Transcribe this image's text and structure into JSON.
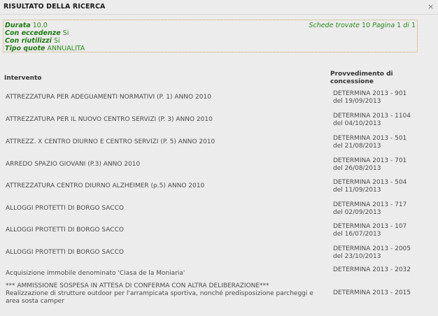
{
  "dialog": {
    "title": "RISULTATO DELLA RICERCA",
    "close_glyph": "×"
  },
  "summary": {
    "durata_label": "Durata",
    "durata_value": "10.0",
    "eccedenze_label": "Con eccedenze",
    "eccedenze_value": "Si",
    "riutilizzi_label": "Con riutilizzi",
    "riutilizzi_value": "Si",
    "tipo_label": "Tipo quote",
    "tipo_value": "ANNUALITA",
    "schede_label": "Schede trovate",
    "schede_value": "10",
    "pagina_label": "Pagina",
    "pagina_value": "1",
    "di_label": "di",
    "pagine_totali": "1"
  },
  "table": {
    "col_intervento": "Intervento",
    "col_provvedimento_1": "Provvedimento di",
    "col_provvedimento_2": "concessione",
    "rows": [
      {
        "intervento": "ATTREZZATURA PER ADEGUAMENTI NORMATIVI (P. 1) ANNO 2010",
        "prov1": "DETERMINA 2013 - 901",
        "prov2": "del 19/09/2013"
      },
      {
        "intervento": "ATTREZZATURA PER IL NUOVO CENTRO SERVIZI (P. 3) ANNO 2010",
        "prov1": "DETERMINA 2013 - 1104",
        "prov2": "del 04/10/2013"
      },
      {
        "intervento": "ATTREZZ. X CENTRO DIURNO E CENTRO SERVIZI (P. 5) ANNO 2010",
        "prov1": "DETERMINA 2013 - 501",
        "prov2": "del 21/08/2013"
      },
      {
        "intervento": "ARREDO SPAZIO GIOVANI (P.3) ANNO 2010",
        "prov1": "DETERMINA 2013 - 701",
        "prov2": "del 26/08/2013"
      },
      {
        "intervento": "ATTREZZATURA CENTRO DIURNO ALZHEIMER (p.5) ANNO 2010",
        "prov1": "DETERMINA 2013 - 504",
        "prov2": "del 11/09/2013"
      },
      {
        "intervento": "ALLOGGI PROTETTI DI BORGO SACCO",
        "prov1": "DETERMINA 2013 - 717",
        "prov2": "del 02/09/2013"
      },
      {
        "intervento": "ALLOGGI PROTETTI DI BORGO SACCO",
        "prov1": "DETERMINA 2013 - 107",
        "prov2": "del 16/07/2013"
      },
      {
        "intervento": "ALLOGGI PROTETTI DI BORGO SACCO",
        "prov1": "DETERMINA 2013 - 2005",
        "prov2": "del 23/10/2013"
      },
      {
        "intervento": "Acquisizione immobile denominato 'Ciasa de la Moniaria'",
        "prov1": "DETERMINA 2013 - 2032",
        "prov2": ""
      },
      {
        "intervento": "*** AMMISSIONE SOSPESA IN ATTESA DI CONFERMA CON ALTRA DELIBERAZIONE*** Realizzazione di strutture outdoor per l'arrampicata sportiva, nonché predisposizione parcheggi e area sosta camper",
        "prov1": "DETERMINA 2013 - 2015",
        "prov2": ""
      }
    ]
  }
}
